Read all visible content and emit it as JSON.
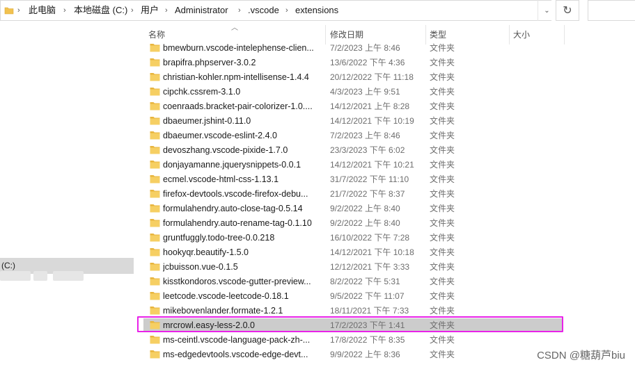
{
  "breadcrumb": [
    "此电脑",
    "本地磁盘 (C:)",
    "用户",
    "Administrator",
    ".vscode",
    "extensions"
  ],
  "columns": {
    "name": "名称",
    "date": "修改日期",
    "type": "类型",
    "size": "大小"
  },
  "nav": {
    "selected_label": "(C:)"
  },
  "rows": [
    {
      "name": "bmewburn.vscode-intelephense-clien...",
      "date": "7/2/2023 上午 8:46",
      "type": "文件夹"
    },
    {
      "name": "brapifra.phpserver-3.0.2",
      "date": "13/6/2022 下午 4:36",
      "type": "文件夹"
    },
    {
      "name": "christian-kohler.npm-intellisense-1.4.4",
      "date": "20/12/2022 下午 11:18",
      "type": "文件夹"
    },
    {
      "name": "cipchk.cssrem-3.1.0",
      "date": "4/3/2023 上午 9:51",
      "type": "文件夹"
    },
    {
      "name": "coenraads.bracket-pair-colorizer-1.0....",
      "date": "14/12/2021 上午 8:28",
      "type": "文件夹"
    },
    {
      "name": "dbaeumer.jshint-0.11.0",
      "date": "14/12/2021 下午 10:19",
      "type": "文件夹"
    },
    {
      "name": "dbaeumer.vscode-eslint-2.4.0",
      "date": "7/2/2023 上午 8:46",
      "type": "文件夹"
    },
    {
      "name": "devoszhang.vscode-pixide-1.7.0",
      "date": "23/3/2023 下午 6:02",
      "type": "文件夹"
    },
    {
      "name": "donjayamanne.jquerysnippets-0.0.1",
      "date": "14/12/2021 下午 10:21",
      "type": "文件夹"
    },
    {
      "name": "ecmel.vscode-html-css-1.13.1",
      "date": "31/7/2022 下午 11:10",
      "type": "文件夹"
    },
    {
      "name": "firefox-devtools.vscode-firefox-debu...",
      "date": "21/7/2022 下午 8:37",
      "type": "文件夹"
    },
    {
      "name": "formulahendry.auto-close-tag-0.5.14",
      "date": "9/2/2022 上午 8:40",
      "type": "文件夹"
    },
    {
      "name": "formulahendry.auto-rename-tag-0.1.10",
      "date": "9/2/2022 上午 8:40",
      "type": "文件夹"
    },
    {
      "name": "gruntfuggly.todo-tree-0.0.218",
      "date": "16/10/2022 下午 7:28",
      "type": "文件夹"
    },
    {
      "name": "hookyqr.beautify-1.5.0",
      "date": "14/12/2021 下午 10:18",
      "type": "文件夹"
    },
    {
      "name": "jcbuisson.vue-0.1.5",
      "date": "12/12/2021 下午 3:33",
      "type": "文件夹"
    },
    {
      "name": "kisstkondoros.vscode-gutter-preview...",
      "date": "8/2/2022 下午 5:31",
      "type": "文件夹"
    },
    {
      "name": "leetcode.vscode-leetcode-0.18.1",
      "date": "9/5/2022 下午 11:07",
      "type": "文件夹"
    },
    {
      "name": "mikebovenlander.formate-1.2.1",
      "date": "18/11/2021 下午 7:33",
      "type": "文件夹"
    },
    {
      "name": "mrcrowl.easy-less-2.0.0",
      "date": "17/2/2023 下午 1:41",
      "type": "文件夹"
    },
    {
      "name": "ms-ceintl.vscode-language-pack-zh-...",
      "date": "17/8/2022 下午 8:35",
      "type": "文件夹"
    },
    {
      "name": "ms-edgedevtools.vscode-edge-devt...",
      "date": "9/9/2022 上午 8:36",
      "type": "文件夹"
    }
  ],
  "watermark": "CSDN @糖葫芦biu",
  "colors": {
    "selection": "#cccccc",
    "highlight": "#e822e8",
    "folder": "#f2c24f"
  }
}
